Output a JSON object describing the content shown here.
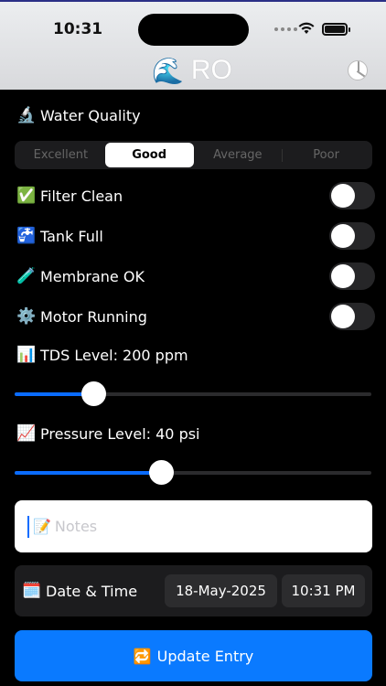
{
  "status_bar": {
    "time": "10:31"
  },
  "header": {
    "emoji": "🌊",
    "title": "RO",
    "chart_button_icon": "pie-chart-icon"
  },
  "water_quality": {
    "icon": "🔬",
    "label": "Water Quality",
    "options": [
      "Excellent",
      "Good",
      "Average",
      "Poor"
    ],
    "selected": "Good"
  },
  "toggles": [
    {
      "icon": "✅",
      "label": "Filter Clean",
      "on": false
    },
    {
      "icon": "🚰",
      "label": "Tank Full",
      "on": false
    },
    {
      "icon": "🧪",
      "label": "Membrane OK",
      "on": false
    },
    {
      "icon": "⚙️",
      "label": "Motor Running",
      "on": false
    }
  ],
  "tds": {
    "icon": "📊",
    "label": "TDS Level: 200 ppm",
    "value": 200,
    "fraction": 0.22
  },
  "pressure": {
    "icon": "📈",
    "label": "Pressure Level: 40 psi",
    "value": 40,
    "fraction": 0.41
  },
  "notes": {
    "icon": "📝",
    "placeholder": "Notes",
    "value": ""
  },
  "datetime": {
    "icon": "🗓️",
    "label": "Date & Time",
    "date": "18-May-2025",
    "time": "10:31 PM"
  },
  "update_button": {
    "icon": "🔁",
    "label": "Update Entry"
  },
  "colors": {
    "accent": "#0A7AFF",
    "background": "#000000"
  }
}
